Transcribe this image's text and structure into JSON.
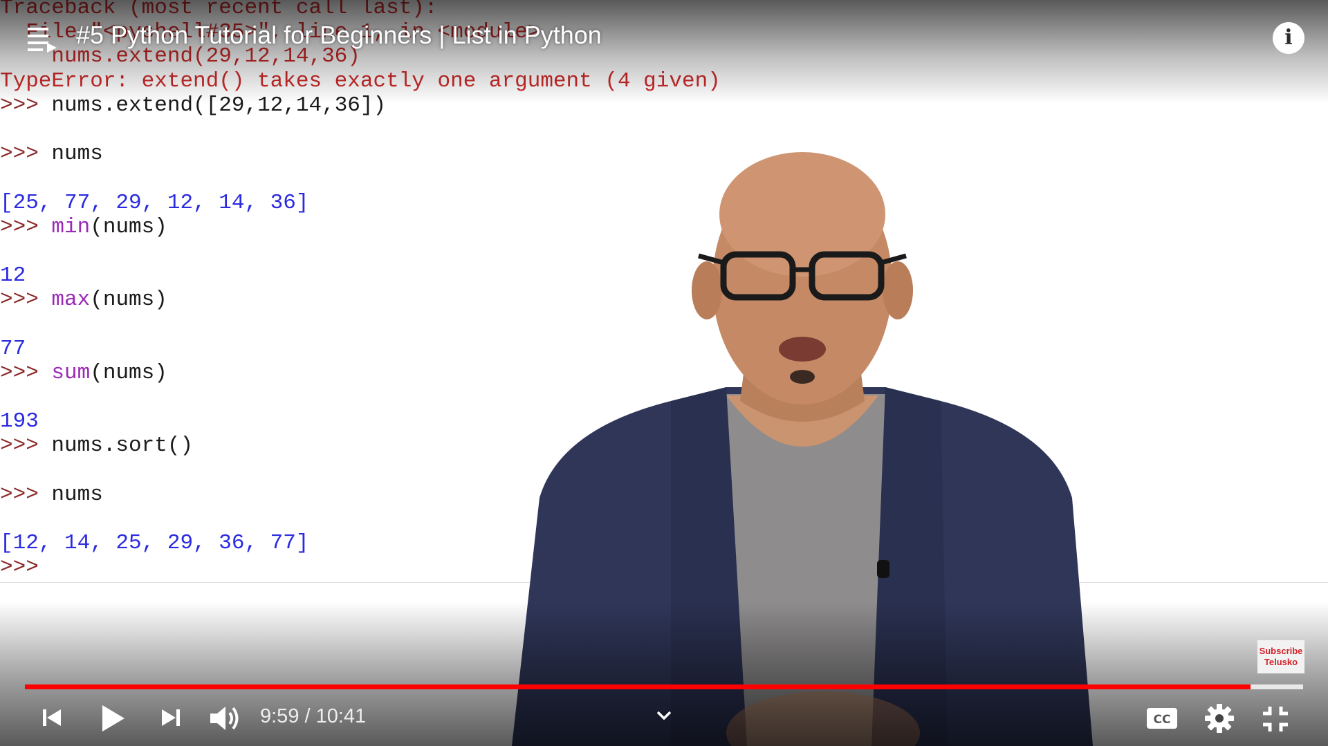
{
  "player": {
    "title": "#5 Python Tutorial for Beginners | List in Python",
    "current_time": "9:59",
    "duration": "10:41",
    "time_display": "9:59 / 10:41",
    "progress_fraction": 0.959,
    "buffered_fraction": 1.0,
    "accent_color": "#ff0000",
    "subscribe_badge": {
      "line1": "Subscribe",
      "line2": "Telusko"
    },
    "icons": {
      "playlist": "playlist-icon",
      "info": "info-icon",
      "previous": "previous-icon",
      "play": "play-icon",
      "next": "next-icon",
      "volume": "volume-icon",
      "chevron": "chevron-down-icon",
      "captions": "closed-captions-icon",
      "settings": "gear-icon",
      "exit_fullscreen": "exit-fullscreen-icon"
    },
    "captions_label": "CC"
  },
  "terminal": {
    "lines": [
      {
        "type": "error",
        "text": "Traceback (most recent call last):"
      },
      {
        "type": "error",
        "text": "  File \"<pyshell#35>\", line 1, in <module>"
      },
      {
        "type": "error",
        "text": "    nums.extend(29,12,14,36)"
      },
      {
        "type": "error",
        "text": "TypeError: extend() takes exactly one argument (4 given)"
      },
      {
        "type": "input",
        "prompt": ">>> ",
        "fn": "",
        "text": "nums.extend([29,12,14,36])"
      },
      {
        "type": "blank",
        "text": ""
      },
      {
        "type": "input",
        "prompt": ">>> ",
        "fn": "",
        "text": "nums"
      },
      {
        "type": "blank",
        "text": ""
      },
      {
        "type": "output",
        "text": "[25, 77, 29, 12, 14, 36]"
      },
      {
        "type": "input",
        "prompt": ">>> ",
        "fn": "min",
        "text": "(nums)"
      },
      {
        "type": "blank",
        "text": ""
      },
      {
        "type": "output",
        "text": "12"
      },
      {
        "type": "input",
        "prompt": ">>> ",
        "fn": "max",
        "text": "(nums)"
      },
      {
        "type": "blank",
        "text": ""
      },
      {
        "type": "output",
        "text": "77"
      },
      {
        "type": "input",
        "prompt": ">>> ",
        "fn": "sum",
        "text": "(nums)"
      },
      {
        "type": "blank",
        "text": ""
      },
      {
        "type": "output",
        "text": "193"
      },
      {
        "type": "input",
        "prompt": ">>> ",
        "fn": "",
        "text": "nums.sort()"
      },
      {
        "type": "blank",
        "text": ""
      },
      {
        "type": "input",
        "prompt": ">>> ",
        "fn": "",
        "text": "nums"
      },
      {
        "type": "blank",
        "text": ""
      },
      {
        "type": "output",
        "text": "[12, 14, 25, 29, 36, 77]"
      },
      {
        "type": "input",
        "prompt": ">>>",
        "fn": "",
        "text": ""
      }
    ]
  }
}
